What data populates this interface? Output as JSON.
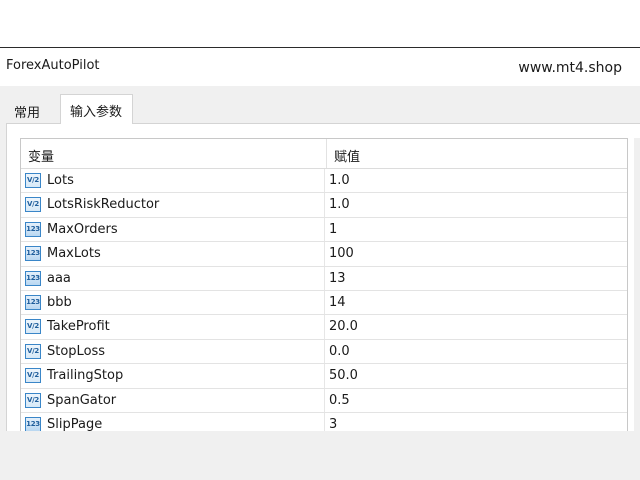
{
  "titlebar": {
    "app_name": "ForexAutoPilot",
    "watermark": "www.mt4.shop"
  },
  "tabs": [
    {
      "label": "常用"
    },
    {
      "label": "输入参数"
    }
  ],
  "grid": {
    "columns": {
      "name": "变量",
      "value": "赋值"
    },
    "rows": [
      {
        "icon": "double-type-icon",
        "icon_text": "V/2",
        "name": "Lots",
        "value": "1.0"
      },
      {
        "icon": "double-type-icon",
        "icon_text": "V/2",
        "name": "LotsRiskReductor",
        "value": "1.0"
      },
      {
        "icon": "integer-type-icon",
        "icon_text": "123",
        "name": "MaxOrders",
        "value": "1"
      },
      {
        "icon": "integer-type-icon",
        "icon_text": "123",
        "name": "MaxLots",
        "value": "100"
      },
      {
        "icon": "integer-type-icon",
        "icon_text": "123",
        "name": "aaa",
        "value": "13"
      },
      {
        "icon": "integer-type-icon",
        "icon_text": "123",
        "name": "bbb",
        "value": "14"
      },
      {
        "icon": "double-type-icon",
        "icon_text": "V/2",
        "name": "TakeProfit",
        "value": "20.0"
      },
      {
        "icon": "double-type-icon",
        "icon_text": "V/2",
        "name": "StopLoss",
        "value": "0.0"
      },
      {
        "icon": "double-type-icon",
        "icon_text": "V/2",
        "name": "TrailingStop",
        "value": "50.0"
      },
      {
        "icon": "double-type-icon",
        "icon_text": "V/2",
        "name": "SpanGator",
        "value": "0.5"
      },
      {
        "icon": "integer-type-icon",
        "icon_text": "123",
        "name": "SlipPage",
        "value": "3"
      }
    ]
  },
  "colors": {
    "icon_border": "#3a86c8",
    "dialog_bg": "#f0f0f0",
    "panel_bg": "#ffffff"
  }
}
